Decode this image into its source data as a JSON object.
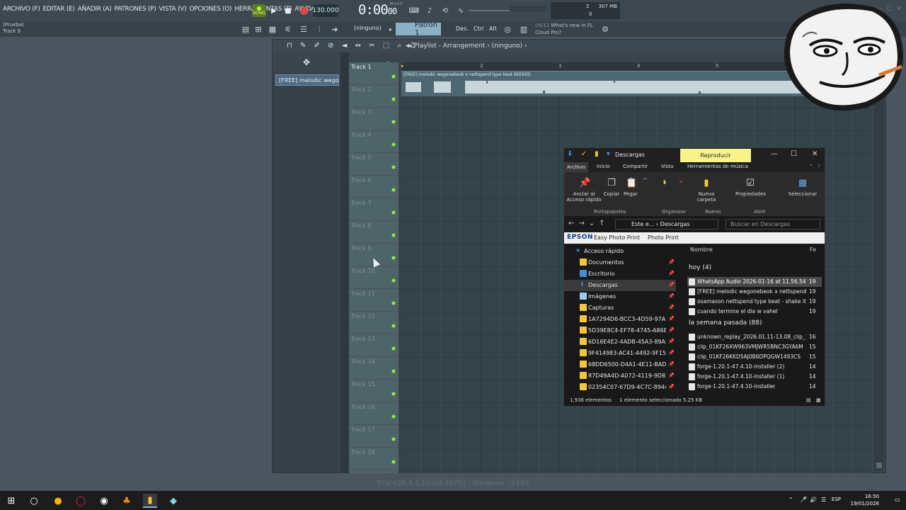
{
  "menu": [
    "ARCHIVO (F)",
    "EDITAR (E)",
    "AÑADIR (A)",
    "PATRONES (P)",
    "VISTA (V)",
    "OPCIONES (O)",
    "HERRAMIENTAS (T)",
    "AYUDA"
  ],
  "transport": {
    "song_label": "SONG",
    "tempo": "130.000",
    "time_main": "0:00",
    "time_sub": "00",
    "time_unit": "M:S:CS"
  },
  "monitor": {
    "cpu": "2",
    "ram": "307 MB",
    "poly": "0"
  },
  "hint": {
    "line1": "(Prueba)",
    "line2": "Track 9"
  },
  "toolbar2": {
    "channel": "(ninguno)",
    "pattern": "Patrón 1",
    "des": "Des.",
    "ctrl": "Ctrl",
    "alt": "Alt"
  },
  "news": {
    "count": "09/12",
    "line1": "What's new in FL",
    "line2": "Cloud Pro?"
  },
  "playlist": {
    "title": "Playlist - Arrangement",
    "pattern_name": "(ninguno)",
    "picker_clip": "[FREE] melodic wego..",
    "ruler": [
      "2",
      "3",
      "4",
      "5"
    ],
    "clip_name": "[FREE] melodic wegonebeok x nettspend type beat 6EEKED",
    "tracks": [
      "Track 1",
      "Track 2",
      "Track 3",
      "Track 4",
      "Track 5",
      "Track 6",
      "Track 7",
      "Track 8",
      "Track 9",
      "Track 10",
      "Track 11",
      "Track 12",
      "Track 13",
      "Track 14",
      "Track 15",
      "Track 16",
      "Track 17",
      "Track 18"
    ]
  },
  "trial": "Trial v25.1.1 [build 4879] - Windows - 64Bit",
  "explorer": {
    "title": "Descargas",
    "play_tab": "Reproducir",
    "tabs": {
      "archivo": "Archivo",
      "inicio": "Inicio",
      "compartir": "Compartir",
      "vista": "Vista",
      "herramientas": "Herramientas de música"
    },
    "ribbon": {
      "anclar": "Anclar al Acceso rápido",
      "copiar": "Copiar",
      "pegar": "Pegar",
      "nueva": "Nueva carpeta",
      "propiedades": "Propiedades",
      "seleccionar": "Seleccionar",
      "groups": {
        "portapapeles": "Portapapeles",
        "organizar": "Organizar",
        "nuevo": "Nuevo",
        "abrir": "Abrir"
      }
    },
    "path": {
      "p1": "Este e...",
      "p2": "Descargas"
    },
    "search_placeholder": "Buscar en Descargas",
    "epson": {
      "brand": "EPSON",
      "easy": "Easy Photo Print",
      "photo": "Photo Print"
    },
    "nav": [
      {
        "label": "Acceso rápido",
        "pin": ""
      },
      {
        "label": "Documentos",
        "pin": "📌"
      },
      {
        "label": "Escritorio",
        "pin": "📌"
      },
      {
        "label": "Descargas",
        "pin": "📌"
      },
      {
        "label": "Imágenes",
        "pin": "📌"
      },
      {
        "label": "Capturas",
        "pin": "📌"
      },
      {
        "label": "1A7294D6-BCC3-4D59-97A5-A",
        "pin": "📌"
      },
      {
        "label": "5D39E8C4-EF78-4745-A86B-29",
        "pin": "📌"
      },
      {
        "label": "6D16E4E2-4ADB-45A3-89A2-33",
        "pin": "📌"
      },
      {
        "label": "9F414983-AC41-4492-9F15-A7B",
        "pin": "📌"
      },
      {
        "label": "68DD6500-D4A1-4E11-BADC-E",
        "pin": "📌"
      },
      {
        "label": "87D49A4D-A072-4119-9D83-DI",
        "pin": "📌"
      },
      {
        "label": "02354C07-67D9-4C7C-8944-AC",
        "pin": "📌"
      }
    ],
    "list_header": {
      "name": "Nombre",
      "date": "Fe"
    },
    "groups": {
      "today": "hoy (4)",
      "lastweek": "la semana pasada (88)"
    },
    "files_today": [
      {
        "name": "WhatsApp Audio 2026-01-16 at 11.56.54 ...",
        "date": "19"
      },
      {
        "name": "[FREE] melodic wegonebeok x nettspend...",
        "date": "19"
      },
      {
        "name": "osamason  nettspend type beat - shake it!!",
        "date": "19"
      },
      {
        "name": "cuando termine el dia w vahel",
        "date": "19"
      }
    ],
    "files_week": [
      {
        "name": "unknown_replay_2026.01.11-13.08_clip_1",
        "date": "16"
      },
      {
        "name": "clip_01KF26XW963VMJWR5BNC3GYA6M",
        "date": "15"
      },
      {
        "name": "clip_01KF26KKD5AJ0B6DPQGW1493CS",
        "date": "15"
      },
      {
        "name": "forge-1.20.1-47.4.10-installer (2)",
        "date": "14"
      },
      {
        "name": "forge-1.20.1-47.4.10-installer (1)",
        "date": "14"
      },
      {
        "name": "forge-1.20.1-47.4.10-installer",
        "date": "14"
      }
    ],
    "status": {
      "count": "1,936 elementos",
      "selected": "1 elemento seleccionado  5.25 KB"
    }
  },
  "taskbar": {
    "lang": "ESP",
    "time": "16:50",
    "date": "19/01/2026"
  },
  "colors": {
    "accent": "#86ff3a",
    "reproducir": "#f6f38a",
    "pattern": "#8bb0c4"
  }
}
